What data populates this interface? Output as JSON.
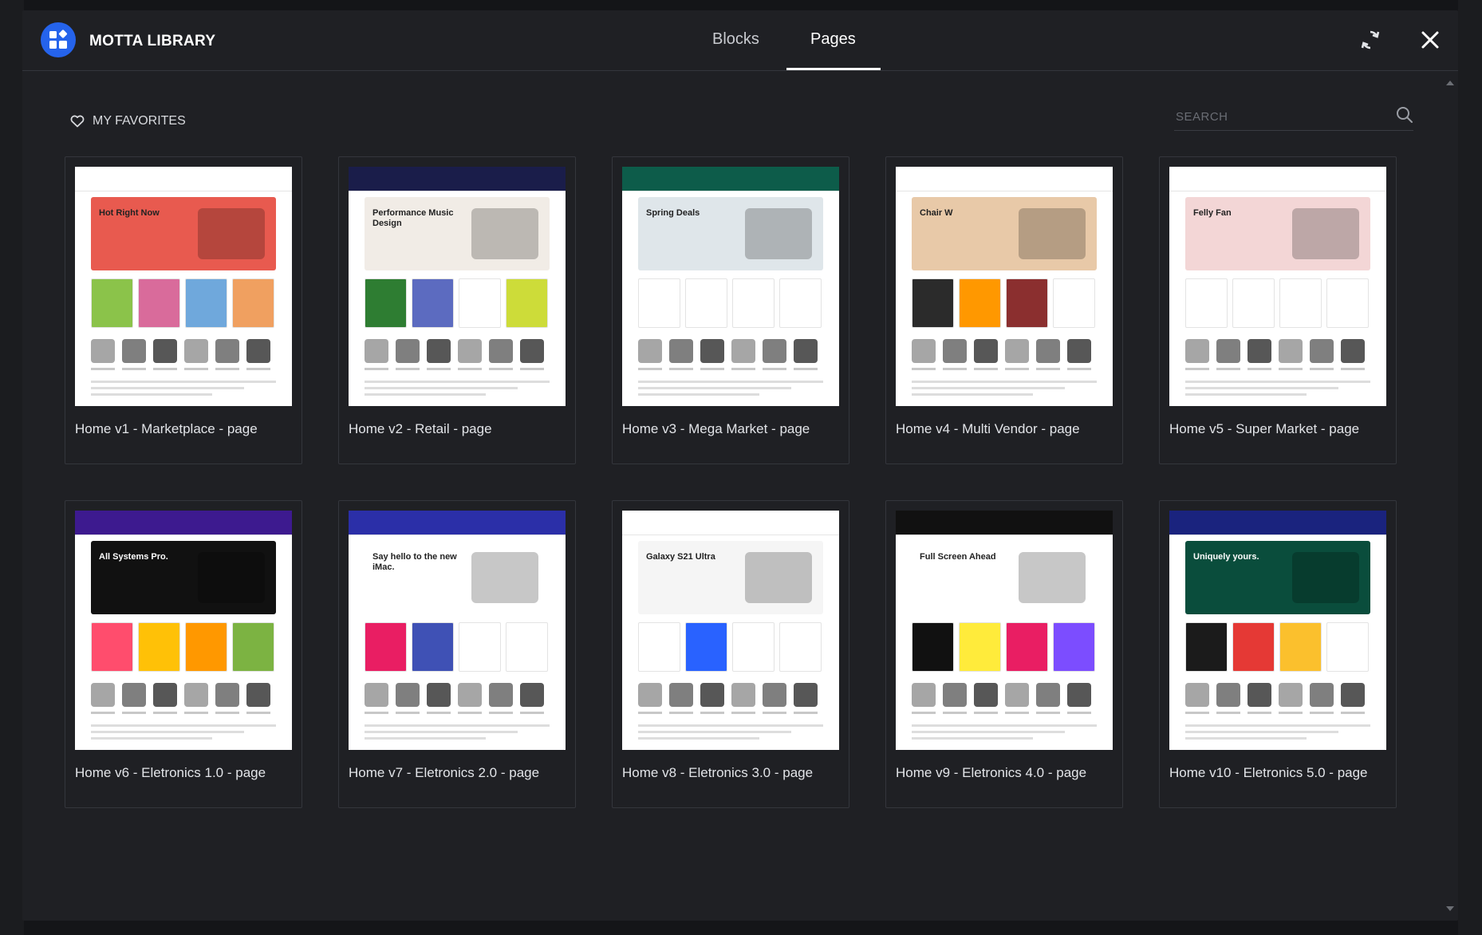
{
  "app": {
    "title": "MOTTA LIBRARY",
    "tabs": [
      {
        "label": "Blocks",
        "active": false
      },
      {
        "label": "Pages",
        "active": true
      }
    ],
    "accent_color": "#2563eb"
  },
  "toolbar": {
    "favorites_label": "MY FAVORITES",
    "search_placeholder": "SEARCH"
  },
  "templates": [
    {
      "title": "Home v1 - Marketplace - page",
      "thumb": {
        "nav": "#ffffff",
        "hero": "#e85a4f",
        "hero_text": "Hot Right Now",
        "band": [
          "#8bc34a",
          "#d96b9b",
          "#6fa8dc",
          "#f0a060"
        ]
      }
    },
    {
      "title": "Home v2 - Retail - page",
      "thumb": {
        "nav": "#1a1d4a",
        "hero": "#f1ece6",
        "hero_text": "Performance Music Design",
        "band": [
          "#2e7d32",
          "#5c6bc0",
          "#ffffff",
          "#cddc39"
        ]
      }
    },
    {
      "title": "Home v3 - Mega Market - page",
      "thumb": {
        "nav": "#0d5c4a",
        "hero": "#dfe6ea",
        "hero_text": "Spring Deals",
        "band": [
          "#ffffff",
          "#ffffff",
          "#ffffff",
          "#ffffff"
        ]
      }
    },
    {
      "title": "Home v4 - Multi Vendor - page",
      "thumb": {
        "nav": "#ffffff",
        "hero": "#e8c9a8",
        "hero_text": "Chair W",
        "band": [
          "#2b2b2b",
          "#ff9800",
          "#8b2f2f",
          "#ffffff"
        ]
      }
    },
    {
      "title": "Home v5 - Super Market - page",
      "thumb": {
        "nav": "#ffffff",
        "hero": "#f3d6d6",
        "hero_text": "Felly Fan",
        "band": [
          "#ffffff",
          "#ffffff",
          "#ffffff",
          "#ffffff"
        ]
      }
    },
    {
      "title": "Home v6 - Eletronics 1.0 - page",
      "thumb": {
        "nav": "#3d1a8f",
        "hero": "#111111",
        "hero_text": "All Systems Pro.",
        "band": [
          "#ff4d6d",
          "#ffc107",
          "#ff9800",
          "#7cb342"
        ]
      }
    },
    {
      "title": "Home v7 - Eletronics 2.0 - page",
      "thumb": {
        "nav": "#2b2fa8",
        "hero": "#ffffff",
        "hero_text": "Say hello to the new iMac.",
        "band": [
          "#e91e63",
          "#3f51b5",
          "#ffffff",
          "#ffffff"
        ]
      }
    },
    {
      "title": "Home v8 - Eletronics 3.0 - page",
      "thumb": {
        "nav": "#ffffff",
        "hero": "#f5f5f5",
        "hero_text": "Galaxy S21 Ultra",
        "band": [
          "#ffffff",
          "#2962ff",
          "#ffffff",
          "#ffffff"
        ]
      }
    },
    {
      "title": "Home v9 - Eletronics 4.0 - page",
      "thumb": {
        "nav": "#111111",
        "hero": "#ffffff",
        "hero_text": "Full Screen Ahead",
        "band": [
          "#111111",
          "#ffeb3b",
          "#e91e63",
          "#7c4dff"
        ]
      }
    },
    {
      "title": "Home v10 - Eletronics 5.0 - page",
      "thumb": {
        "nav": "#1a237e",
        "hero": "#0a4d3c",
        "hero_text": "Uniquely yours.",
        "band": [
          "#1b1b1b",
          "#e53935",
          "#fbc02d",
          "#ffffff"
        ]
      }
    }
  ]
}
